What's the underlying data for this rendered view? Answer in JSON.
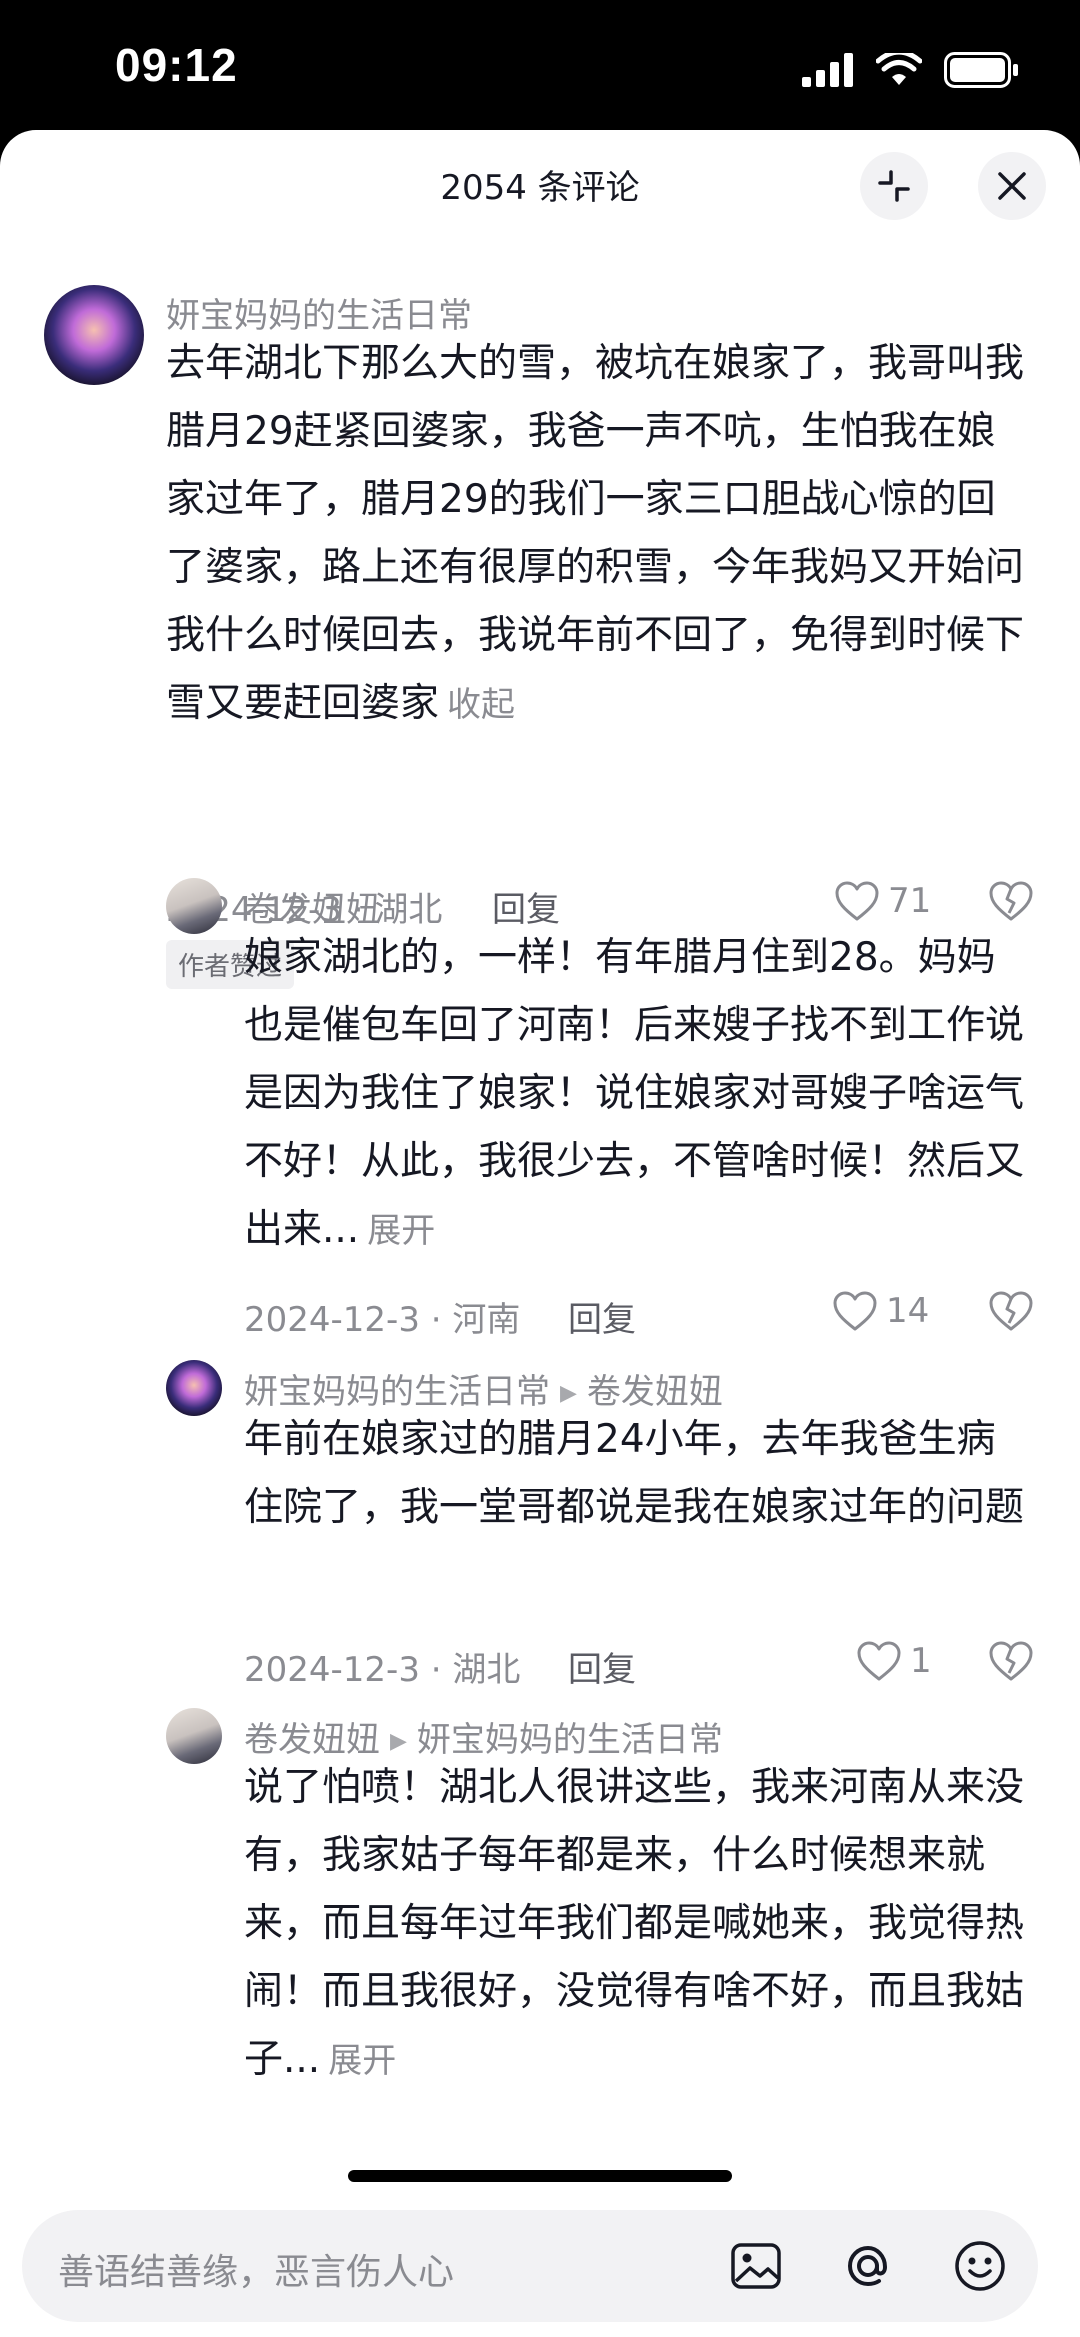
{
  "status_bar": {
    "time": "09:12"
  },
  "header": {
    "title": "2054 条评论"
  },
  "comments": [
    {
      "username": "妍宝妈妈的生活日常",
      "text": "去年湖北下那么大的雪，被坑在娘家了，我哥叫我腊月29赶紧回婆家，我爸一声不吭，生怕我在娘家过年了，腊月29的我们一家三口胆战心惊的回了婆家，路上还有很厚的积雪，今年我妈又开始问我什么时候回去，我说年前不回了，免得到时候下雪又要赶回婆家",
      "toggle": "收起",
      "date_location": "2024-12-3 · 湖北",
      "reply": "回复",
      "likes": "71",
      "badge": "作者赞过"
    },
    {
      "username": "卷发妞妞",
      "text": "娘家湖北的，一样！有年腊月住到28。妈妈也是催包车回了河南！后来嫂子找不到工作说是因为我住了娘家！说住娘家对哥嫂子啥运气不好！从此，我很少去，不管啥时候！然后又出来...",
      "toggle": "展开",
      "date_location": "2024-12-3 · 河南",
      "reply": "回复",
      "likes": "14"
    },
    {
      "username": "妍宝妈妈的生活日常",
      "reply_to": "卷发妞妞",
      "text": "年前在娘家过的腊月24小年，去年我爸生病住院了，我一堂哥都说是我在娘家过年的问题",
      "date_location": "2024-12-3 · 湖北",
      "reply": "回复",
      "likes": "1"
    },
    {
      "username": "卷发妞妞",
      "reply_to": "妍宝妈妈的生活日常",
      "text": "说了怕喷！湖北人很讲这些，我来河南从来没有，我家姑子每年都是来，什么时候想来就来，而且每年过年我们都是喊她来，我觉得热闹！而且我很好，没觉得有啥不好，而且我姑子...",
      "toggle": "展开"
    }
  ],
  "input": {
    "placeholder": "善语结善缘，恶言伤人心"
  }
}
